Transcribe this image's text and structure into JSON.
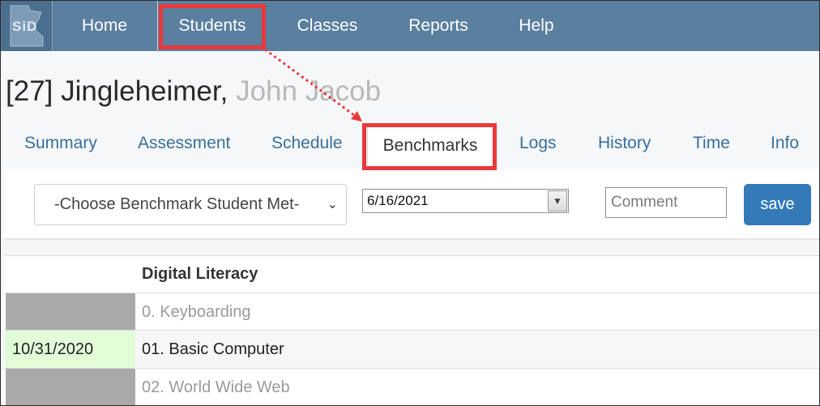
{
  "nav": {
    "logo_text": "SiD",
    "items": [
      "Home",
      "Students",
      "Classes",
      "Reports",
      "Help"
    ]
  },
  "student": {
    "id_prefix": "[27]",
    "last_name": "Jingleheimer,",
    "first_names": "John Jacob"
  },
  "tabs": [
    "Summary",
    "Assessment",
    "Schedule",
    "Benchmarks",
    "Logs",
    "History",
    "Time",
    "Info"
  ],
  "active_tab": "Benchmarks",
  "toolbar": {
    "benchmark_select": "-Choose Benchmark Student Met-",
    "date_value": "6/16/2021",
    "comment_placeholder": "Comment",
    "save_label": "save"
  },
  "section": {
    "title": "Digital Literacy",
    "rows": [
      {
        "date": "",
        "label": "0. Keyboarding",
        "state": "disabled"
      },
      {
        "date": "10/31/2020",
        "label": "01. Basic Computer",
        "state": "done"
      },
      {
        "date": "",
        "label": "02. World Wide Web",
        "state": "disabled"
      }
    ]
  },
  "colors": {
    "nav_bg": "#5a7f9f",
    "annotation_red": "#e8393d",
    "save_blue": "#337ab7",
    "completed_green": "#e2fcd8",
    "locked_gray": "#a9a9a9"
  }
}
